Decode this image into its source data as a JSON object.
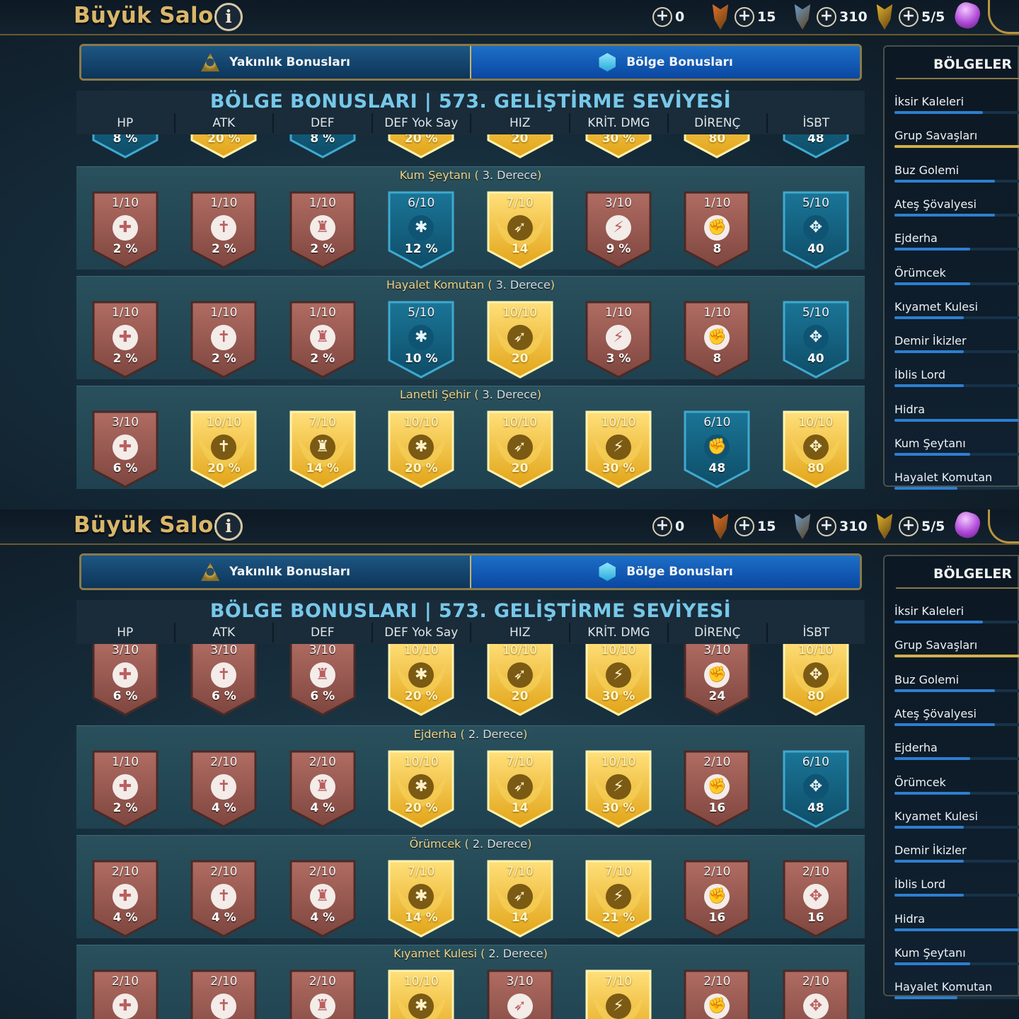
{
  "screen_title": "Büyük Salon",
  "info_label": "i",
  "resources": [
    {
      "value": "0",
      "icon": "orange-banner-icon"
    },
    {
      "value": "15",
      "icon": "blue-banner-icon"
    },
    {
      "value": "310",
      "icon": "gold-banner-icon"
    },
    {
      "value": "5/5",
      "icon": "purple-gem-icon"
    }
  ],
  "tabs": {
    "affinity": "Yakınlık Bonusları",
    "region": "Bölge Bonusları",
    "active": "region"
  },
  "sidebar": {
    "title": "BÖLGELER",
    "items": [
      {
        "label": "İksir Kaleleri",
        "progress": 0.7
      },
      {
        "label": "Grup Savaşları",
        "progress": 1.0,
        "selected": true
      },
      {
        "label": "Buz Golemi",
        "progress": 0.8
      },
      {
        "label": "Ateş Şövalyesi",
        "progress": 0.8
      },
      {
        "label": "Ejderha",
        "progress": 0.6
      },
      {
        "label": "Örümcek",
        "progress": 0.6
      },
      {
        "label": "Kıyamet Kulesi",
        "progress": 0.55
      },
      {
        "label": "Demir İkizler",
        "progress": 0.55
      },
      {
        "label": "İblis Lord",
        "progress": 0.55
      },
      {
        "label": "Hidra",
        "progress": 1.0
      },
      {
        "label": "Kum Şeytanı",
        "progress": 0.6
      },
      {
        "label": "Hayalet Komutan",
        "progress": 0.5
      }
    ]
  },
  "bonus_header": {
    "title": "BÖLGE BONUSLARI | 573. GELİŞTİRME SEVİYESİ",
    "columns": [
      "HP",
      "ATK",
      "DEF",
      "DEF Yok Say",
      "HIZ",
      "KRİT. DMG",
      "DİRENÇ",
      "İSBT"
    ]
  },
  "panels": [
    {
      "partial_row": {
        "name": "",
        "cells": [
          {
            "level": "",
            "bonus": "8 %",
            "tier": "blue"
          },
          {
            "level": "",
            "bonus": "20 %",
            "tier": "gold"
          },
          {
            "level": "",
            "bonus": "8 %",
            "tier": "blue"
          },
          {
            "level": "",
            "bonus": "20 %",
            "tier": "gold"
          },
          {
            "level": "",
            "bonus": "20",
            "tier": "gold"
          },
          {
            "level": "",
            "bonus": "30 %",
            "tier": "gold"
          },
          {
            "level": "",
            "bonus": "80",
            "tier": "gold"
          },
          {
            "level": "",
            "bonus": "48",
            "tier": "blue"
          }
        ]
      },
      "groups": [
        {
          "name": "Kum Şeytanı",
          "degree": "3. Derece",
          "cells": [
            {
              "level": "1/10",
              "bonus": "2 %",
              "tier": "red"
            },
            {
              "level": "1/10",
              "bonus": "2 %",
              "tier": "red"
            },
            {
              "level": "1/10",
              "bonus": "2 %",
              "tier": "red"
            },
            {
              "level": "6/10",
              "bonus": "12 %",
              "tier": "blue"
            },
            {
              "level": "7/10",
              "bonus": "14",
              "tier": "gold"
            },
            {
              "level": "3/10",
              "bonus": "9 %",
              "tier": "red"
            },
            {
              "level": "1/10",
              "bonus": "8",
              "tier": "red"
            },
            {
              "level": "5/10",
              "bonus": "40",
              "tier": "blue"
            }
          ]
        },
        {
          "name": "Hayalet Komutan",
          "degree": "3. Derece",
          "cells": [
            {
              "level": "1/10",
              "bonus": "2 %",
              "tier": "red"
            },
            {
              "level": "1/10",
              "bonus": "2 %",
              "tier": "red"
            },
            {
              "level": "1/10",
              "bonus": "2 %",
              "tier": "red"
            },
            {
              "level": "5/10",
              "bonus": "10 %",
              "tier": "blue"
            },
            {
              "level": "10/10",
              "bonus": "20",
              "tier": "gold"
            },
            {
              "level": "1/10",
              "bonus": "3 %",
              "tier": "red"
            },
            {
              "level": "1/10",
              "bonus": "8",
              "tier": "red"
            },
            {
              "level": "5/10",
              "bonus": "40",
              "tier": "blue"
            }
          ]
        },
        {
          "name": "Lanetli Şehir",
          "degree": "3. Derece",
          "cells": [
            {
              "level": "3/10",
              "bonus": "6 %",
              "tier": "red"
            },
            {
              "level": "10/10",
              "bonus": "20 %",
              "tier": "gold"
            },
            {
              "level": "7/10",
              "bonus": "14 %",
              "tier": "gold"
            },
            {
              "level": "10/10",
              "bonus": "20 %",
              "tier": "gold"
            },
            {
              "level": "10/10",
              "bonus": "20",
              "tier": "gold"
            },
            {
              "level": "10/10",
              "bonus": "30 %",
              "tier": "gold"
            },
            {
              "level": "6/10",
              "bonus": "48",
              "tier": "blue"
            },
            {
              "level": "10/10",
              "bonus": "80",
              "tier": "gold"
            }
          ]
        }
      ]
    },
    {
      "partial_row": {
        "name": "",
        "cells": [
          {
            "level": "3/10",
            "bonus": "6 %",
            "tier": "red"
          },
          {
            "level": "3/10",
            "bonus": "6 %",
            "tier": "red"
          },
          {
            "level": "3/10",
            "bonus": "6 %",
            "tier": "red"
          },
          {
            "level": "10/10",
            "bonus": "20 %",
            "tier": "gold"
          },
          {
            "level": "10/10",
            "bonus": "20",
            "tier": "gold"
          },
          {
            "level": "10/10",
            "bonus": "30 %",
            "tier": "gold"
          },
          {
            "level": "3/10",
            "bonus": "24",
            "tier": "red"
          },
          {
            "level": "10/10",
            "bonus": "80",
            "tier": "gold"
          }
        ]
      },
      "groups": [
        {
          "name": "Ejderha",
          "degree": "2. Derece",
          "cells": [
            {
              "level": "1/10",
              "bonus": "2 %",
              "tier": "red"
            },
            {
              "level": "2/10",
              "bonus": "4 %",
              "tier": "red"
            },
            {
              "level": "2/10",
              "bonus": "4 %",
              "tier": "red"
            },
            {
              "level": "10/10",
              "bonus": "20 %",
              "tier": "gold"
            },
            {
              "level": "7/10",
              "bonus": "14",
              "tier": "gold"
            },
            {
              "level": "10/10",
              "bonus": "30 %",
              "tier": "gold"
            },
            {
              "level": "2/10",
              "bonus": "16",
              "tier": "red"
            },
            {
              "level": "6/10",
              "bonus": "48",
              "tier": "blue"
            }
          ]
        },
        {
          "name": "Örümcek",
          "degree": "2. Derece",
          "cells": [
            {
              "level": "2/10",
              "bonus": "4 %",
              "tier": "red"
            },
            {
              "level": "2/10",
              "bonus": "4 %",
              "tier": "red"
            },
            {
              "level": "2/10",
              "bonus": "4 %",
              "tier": "red"
            },
            {
              "level": "7/10",
              "bonus": "14 %",
              "tier": "gold"
            },
            {
              "level": "7/10",
              "bonus": "14",
              "tier": "gold"
            },
            {
              "level": "7/10",
              "bonus": "21 %",
              "tier": "gold"
            },
            {
              "level": "2/10",
              "bonus": "16",
              "tier": "red"
            },
            {
              "level": "2/10",
              "bonus": "16",
              "tier": "red"
            }
          ]
        },
        {
          "name": "Kıyamet Kulesi",
          "degree": "2. Derece",
          "cells": [
            {
              "level": "2/10",
              "bonus": "",
              "tier": "red"
            },
            {
              "level": "2/10",
              "bonus": "",
              "tier": "red"
            },
            {
              "level": "2/10",
              "bonus": "",
              "tier": "red"
            },
            {
              "level": "10/10",
              "bonus": "",
              "tier": "gold"
            },
            {
              "level": "3/10",
              "bonus": "",
              "tier": "red"
            },
            {
              "level": "7/10",
              "bonus": "",
              "tier": "gold"
            },
            {
              "level": "2/10",
              "bonus": "",
              "tier": "red"
            },
            {
              "level": "2/10",
              "bonus": "",
              "tier": "red"
            }
          ]
        }
      ]
    }
  ],
  "colors": {
    "red": "#9c5a52",
    "blue": "#14607f",
    "gold": "#f2c23a",
    "accent": "#d9b66a"
  },
  "stat_icons": [
    "hp-icon",
    "atk-icon",
    "def-icon",
    "def-ignore-icon",
    "speed-icon",
    "crit-dmg-icon",
    "resist-icon",
    "accuracy-icon"
  ]
}
